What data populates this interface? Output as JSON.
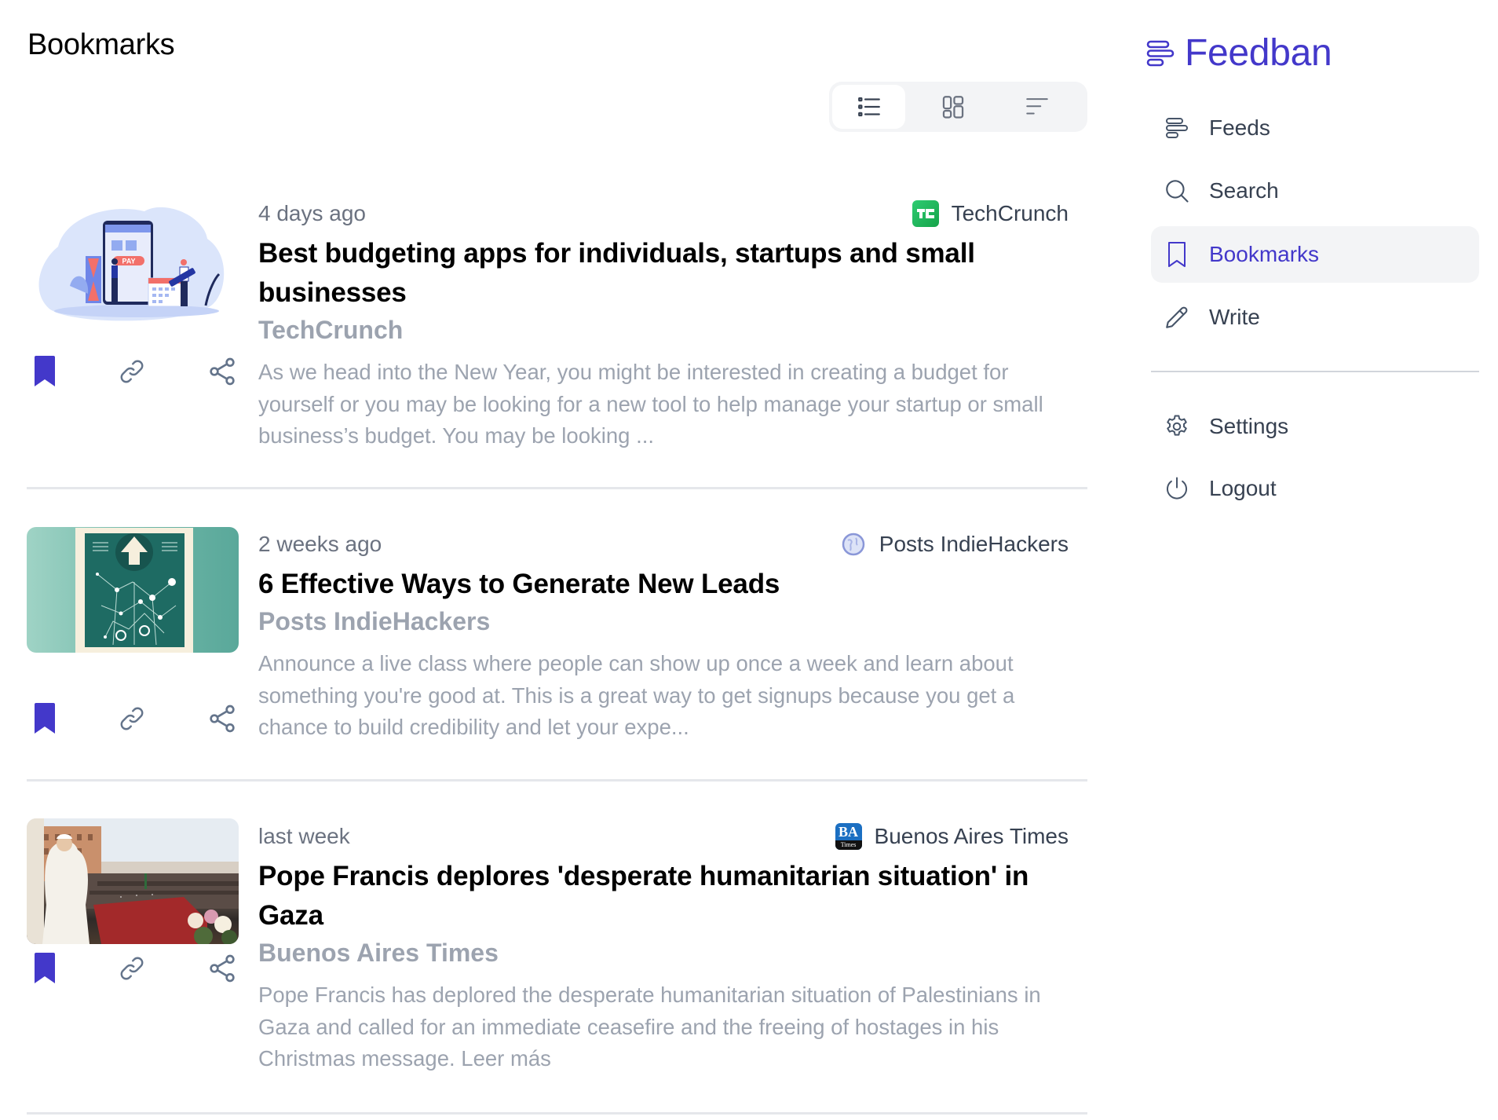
{
  "header": {
    "title": "Bookmarks"
  },
  "view_toggle": {
    "options": [
      {
        "name": "list-view",
        "icon": "list-icon",
        "active": true
      },
      {
        "name": "grid-view",
        "icon": "grid-icon",
        "active": false
      },
      {
        "name": "compact-view",
        "icon": "sort-lines-icon",
        "active": false
      }
    ]
  },
  "articles": [
    {
      "time": "4 days ago",
      "source": "TechCrunch",
      "source_icon": "techcrunch-logo",
      "title": "Best budgeting apps for individuals, startups and small businesses",
      "source_label": "TechCrunch",
      "description": "As we head into the New Year, you might be interested in creating a budget for yourself or you may be looking for a new tool to help manage your startup or small business’s budget. You may be looking ...",
      "thumbnail": "budgeting-illustration",
      "bookmarked": true
    },
    {
      "time": "2 weeks ago",
      "source": "Posts IndieHackers",
      "source_icon": "globe-logo",
      "title": "6 Effective Ways to Generate New Leads",
      "source_label": "Posts IndieHackers",
      "description": "Announce a live class where people can show up once a week and learn about something you're good at. This is a great way to get signups because you get a chance to build credibility and let your expe...",
      "thumbnail": "growth-network-illustration",
      "bookmarked": true
    },
    {
      "time": "last week",
      "source": "Buenos Aires Times",
      "source_icon": "ba-times-logo",
      "title": "Pope Francis deplores 'desperate humanitarian situation' in Gaza",
      "source_label": "Buenos Aires Times",
      "description": "Pope Francis has deplored the desperate humanitarian situation of Palestinians in Gaza and called for an immediate ceasefire and the freeing of hostages in his Christmas message. Leer más",
      "thumbnail": "pope-balcony-photo",
      "bookmarked": true
    }
  ],
  "sidebar": {
    "brand": "Feedban",
    "brand_color": "#4338ca",
    "items": [
      {
        "label": "Feeds",
        "icon": "feeds-icon",
        "active": false
      },
      {
        "label": "Search",
        "icon": "search-icon",
        "active": false
      },
      {
        "label": "Bookmarks",
        "icon": "bookmark-icon",
        "active": true
      },
      {
        "label": "Write",
        "icon": "pencil-icon",
        "active": false
      }
    ],
    "bottom_items": [
      {
        "label": "Settings",
        "icon": "gear-icon"
      },
      {
        "label": "Logout",
        "icon": "power-icon"
      }
    ]
  },
  "colors": {
    "accent": "#4338ca",
    "muted_text": "#9ca3af",
    "meta_text": "#6b7280",
    "icon_gray": "#64748b"
  }
}
